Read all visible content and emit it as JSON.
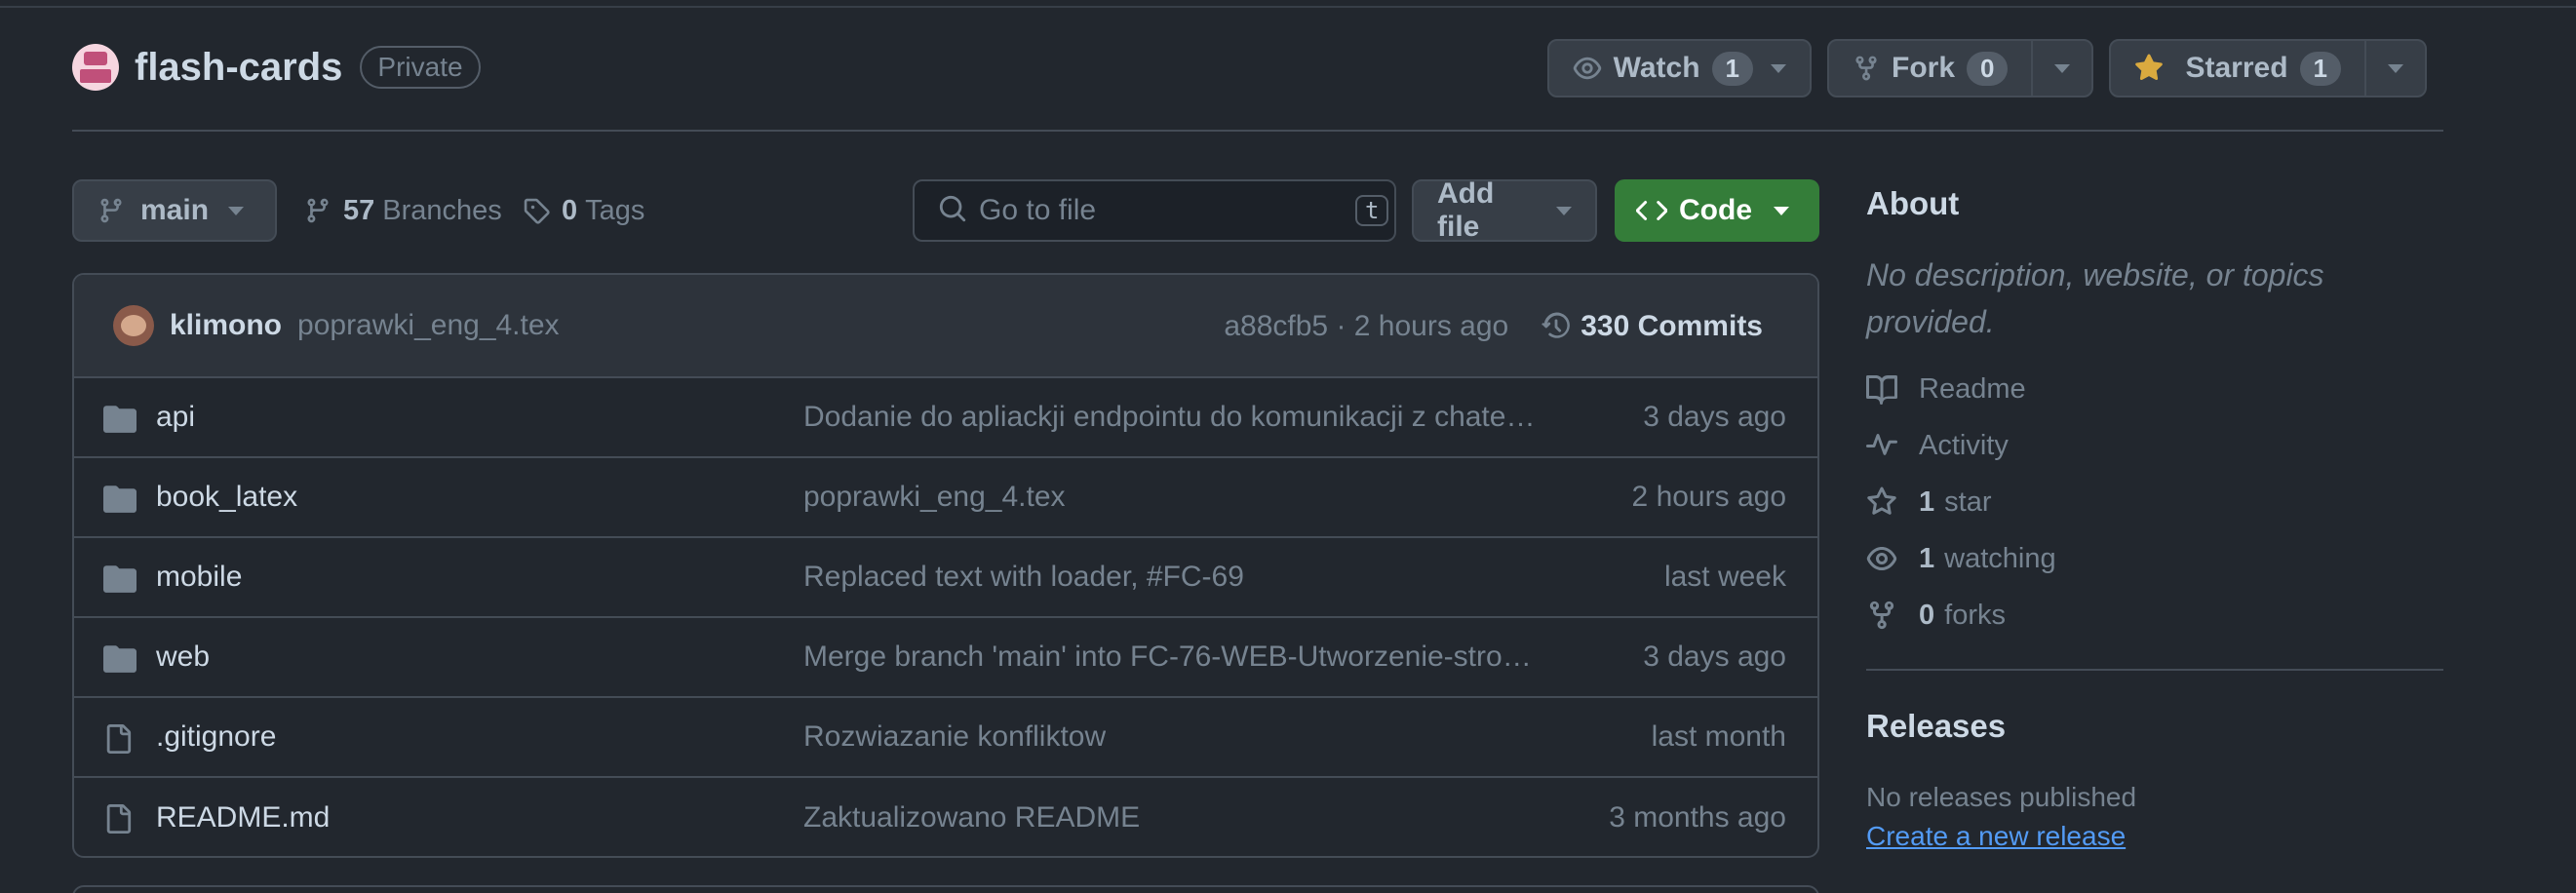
{
  "repo": {
    "name": "flash-cards",
    "visibility": "Private"
  },
  "actions": {
    "watch": {
      "label": "Watch",
      "count": "1"
    },
    "fork": {
      "label": "Fork",
      "count": "0"
    },
    "star": {
      "label": "Starred",
      "count": "1",
      "color": "#daaa3f"
    }
  },
  "toolbar": {
    "branch": "main",
    "branches_count": "57",
    "branches_label": "Branches",
    "tags_count": "0",
    "tags_label": "Tags",
    "search_placeholder": "Go to file",
    "search_shortcut": "t",
    "add_file": "Add file",
    "code": "Code"
  },
  "latest_commit": {
    "author": "klimono",
    "message": "poprawki_eng_4.tex",
    "hash_time": "a88cfb5 · 2 hours ago",
    "commits_count": "330",
    "commits_label": "Commits"
  },
  "files": [
    {
      "type": "folder",
      "name": "api",
      "commit": "Dodanie do apliackji endpointu do komunikacji z chatem ...",
      "time": "3 days ago"
    },
    {
      "type": "folder",
      "name": "book_latex",
      "commit": "poprawki_eng_4.tex",
      "time": "2 hours ago"
    },
    {
      "type": "folder",
      "name": "mobile",
      "commit": "Replaced text with loader, #FC-69",
      "time": "last week"
    },
    {
      "type": "folder",
      "name": "web",
      "commit": "Merge branch 'main' into FC-76-WEB-Utworzenie-strony...",
      "time": "3 days ago"
    },
    {
      "type": "file",
      "name": ".gitignore",
      "commit": "Rozwiazanie konfliktow",
      "time": "last month"
    },
    {
      "type": "file",
      "name": "README.md",
      "commit": "Zaktualizowano README",
      "time": "3 months ago"
    }
  ],
  "about": {
    "title": "About",
    "description": "No description, website, or topics provided.",
    "readme": "Readme",
    "activity": "Activity",
    "stars_count": "1",
    "stars_label": "star",
    "watching_count": "1",
    "watching_label": "watching",
    "forks_count": "0",
    "forks_label": "forks"
  },
  "releases": {
    "title": "Releases",
    "none": "No releases published",
    "create": "Create a new release"
  },
  "colors": {
    "background": "#22272e",
    "border": "#444c56",
    "code_button": "#347d39",
    "link": "#539bf5"
  }
}
